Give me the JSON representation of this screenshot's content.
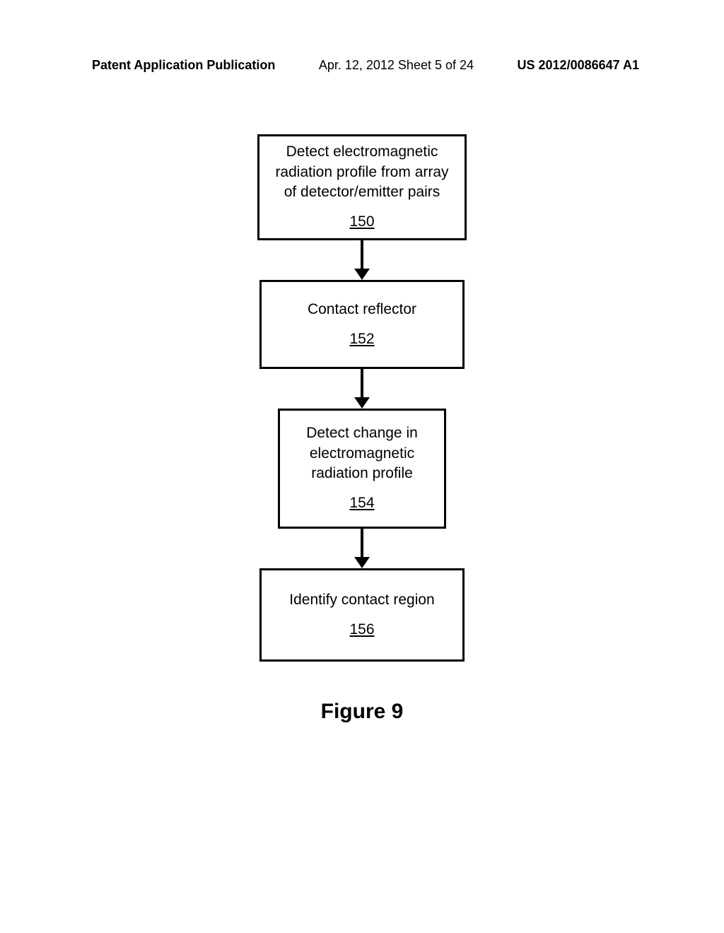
{
  "header": {
    "left": "Patent Application Publication",
    "center": "Apr. 12, 2012  Sheet 5 of 24",
    "right": "US 2012/0086647 A1"
  },
  "flowchart": {
    "steps": [
      {
        "text": "Detect electromagnetic radiation profile from array of detector/emitter pairs",
        "ref": "150"
      },
      {
        "text": "Contact reflector",
        "ref": "152"
      },
      {
        "text": "Detect change in electromagnetic radiation profile",
        "ref": "154"
      },
      {
        "text": "Identify contact region",
        "ref": "156"
      }
    ]
  },
  "figure_title": "Figure 9"
}
